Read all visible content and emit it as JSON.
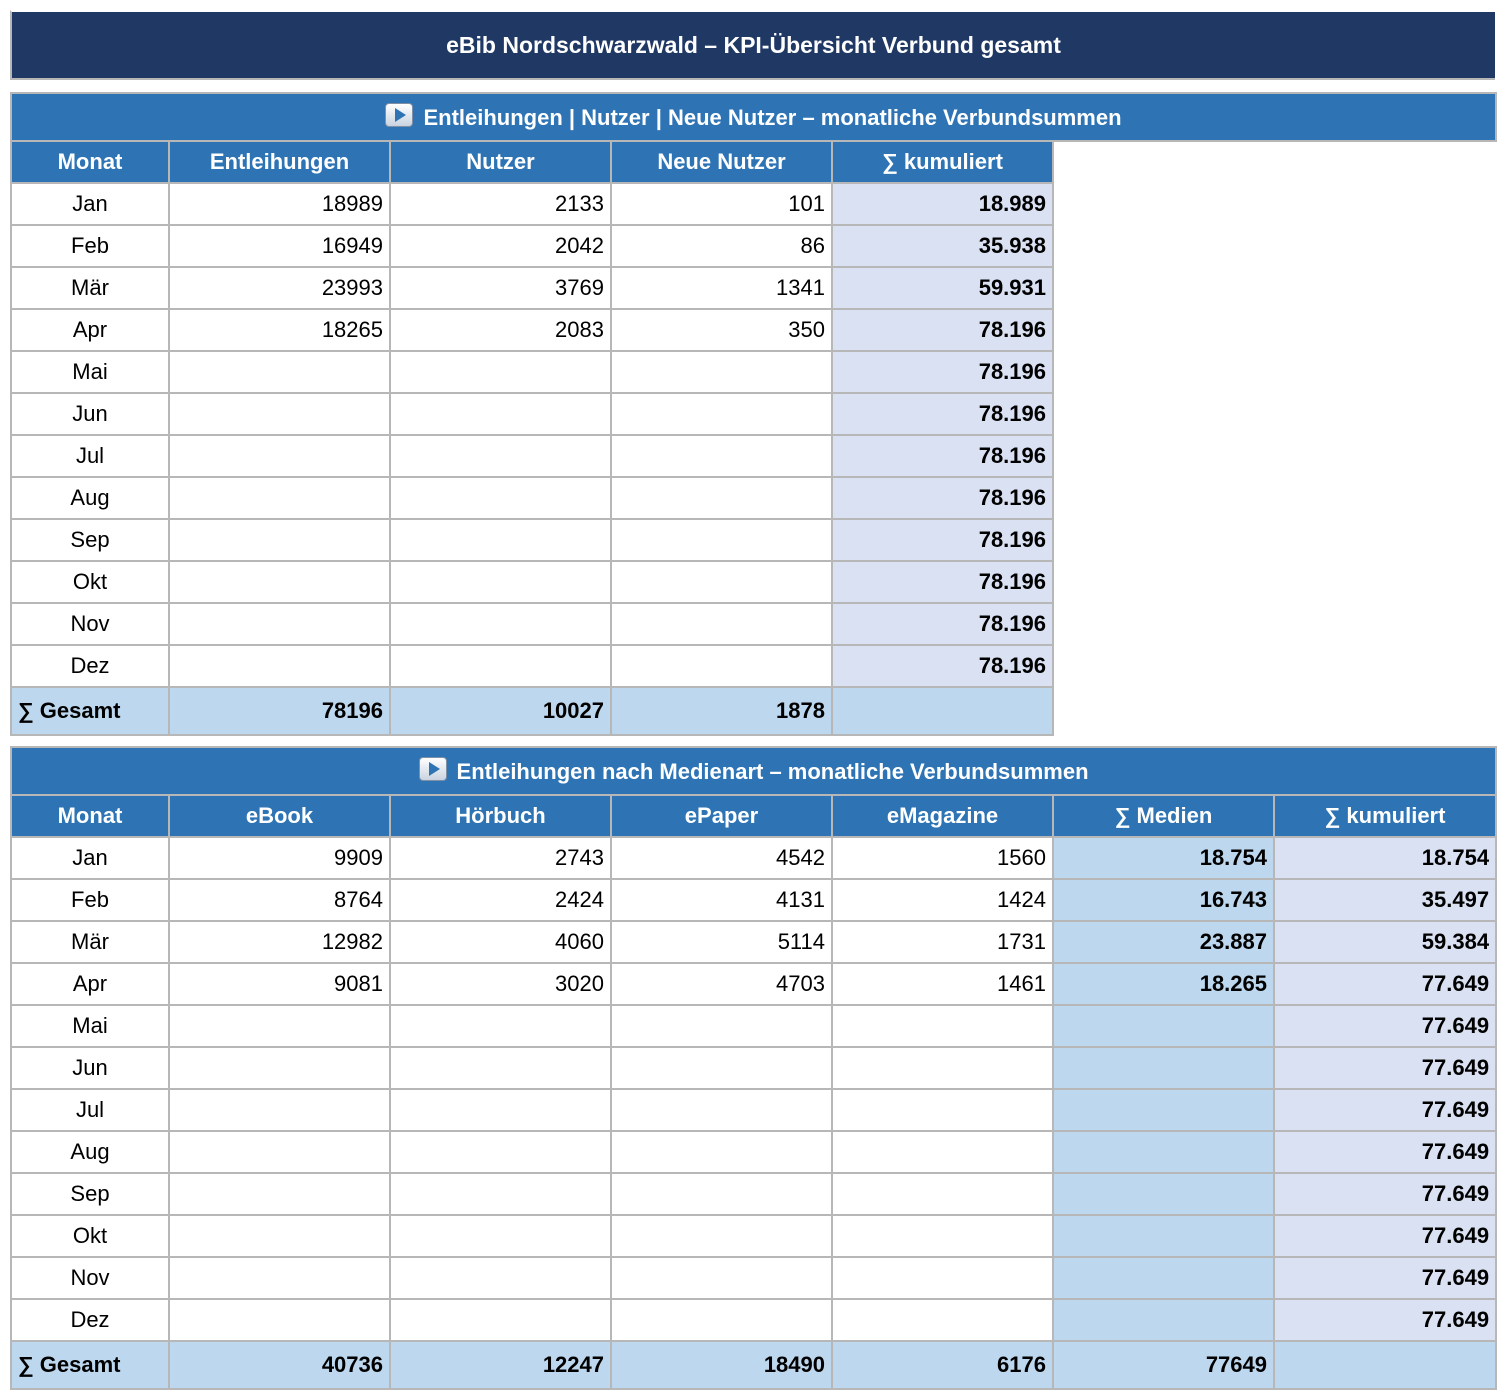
{
  "title": "eBib Nordschwarzwald – KPI-Übersicht Verbund gesamt",
  "table1": {
    "heading": "Entleihungen | Nutzer | Neue Nutzer  –  monatliche Verbundsummen",
    "columns": [
      "Monat",
      "Entleihungen",
      "Nutzer",
      "Neue Nutzer",
      "∑ kumuliert"
    ],
    "rows": [
      {
        "month": "Jan",
        "entleihungen": "18989",
        "nutzer": "2133",
        "neue": "101",
        "kum": "18.989"
      },
      {
        "month": "Feb",
        "entleihungen": "16949",
        "nutzer": "2042",
        "neue": "86",
        "kum": "35.938"
      },
      {
        "month": "Mär",
        "entleihungen": "23993",
        "nutzer": "3769",
        "neue": "1341",
        "kum": "59.931"
      },
      {
        "month": "Apr",
        "entleihungen": "18265",
        "nutzer": "2083",
        "neue": "350",
        "kum": "78.196"
      },
      {
        "month": "Mai",
        "entleihungen": "",
        "nutzer": "",
        "neue": "",
        "kum": "78.196"
      },
      {
        "month": "Jun",
        "entleihungen": "",
        "nutzer": "",
        "neue": "",
        "kum": "78.196"
      },
      {
        "month": "Jul",
        "entleihungen": "",
        "nutzer": "",
        "neue": "",
        "kum": "78.196"
      },
      {
        "month": "Aug",
        "entleihungen": "",
        "nutzer": "",
        "neue": "",
        "kum": "78.196"
      },
      {
        "month": "Sep",
        "entleihungen": "",
        "nutzer": "",
        "neue": "",
        "kum": "78.196"
      },
      {
        "month": "Okt",
        "entleihungen": "",
        "nutzer": "",
        "neue": "",
        "kum": "78.196"
      },
      {
        "month": "Nov",
        "entleihungen": "",
        "nutzer": "",
        "neue": "",
        "kum": "78.196"
      },
      {
        "month": "Dez",
        "entleihungen": "",
        "nutzer": "",
        "neue": "",
        "kum": "78.196"
      }
    ],
    "total": {
      "label": "∑ Gesamt",
      "entleihungen": "78196",
      "nutzer": "10027",
      "neue": "1878"
    }
  },
  "table2": {
    "heading": "Entleihungen nach Medienart  –  monatliche Verbundsummen",
    "columns": [
      "Monat",
      "eBook",
      "Hörbuch",
      "ePaper",
      "eMagazine",
      "∑ Medien",
      "∑ kumuliert"
    ],
    "rows": [
      {
        "month": "Jan",
        "ebook": "9909",
        "hoerbuch": "2743",
        "epaper": "4542",
        "emagazine": "1560",
        "medien": "18.754",
        "kum": "18.754"
      },
      {
        "month": "Feb",
        "ebook": "8764",
        "hoerbuch": "2424",
        "epaper": "4131",
        "emagazine": "1424",
        "medien": "16.743",
        "kum": "35.497"
      },
      {
        "month": "Mär",
        "ebook": "12982",
        "hoerbuch": "4060",
        "epaper": "5114",
        "emagazine": "1731",
        "medien": "23.887",
        "kum": "59.384"
      },
      {
        "month": "Apr",
        "ebook": "9081",
        "hoerbuch": "3020",
        "epaper": "4703",
        "emagazine": "1461",
        "medien": "18.265",
        "kum": "77.649"
      },
      {
        "month": "Mai",
        "ebook": "",
        "hoerbuch": "",
        "epaper": "",
        "emagazine": "",
        "medien": "",
        "kum": "77.649"
      },
      {
        "month": "Jun",
        "ebook": "",
        "hoerbuch": "",
        "epaper": "",
        "emagazine": "",
        "medien": "",
        "kum": "77.649"
      },
      {
        "month": "Jul",
        "ebook": "",
        "hoerbuch": "",
        "epaper": "",
        "emagazine": "",
        "medien": "",
        "kum": "77.649"
      },
      {
        "month": "Aug",
        "ebook": "",
        "hoerbuch": "",
        "epaper": "",
        "emagazine": "",
        "medien": "",
        "kum": "77.649"
      },
      {
        "month": "Sep",
        "ebook": "",
        "hoerbuch": "",
        "epaper": "",
        "emagazine": "",
        "medien": "",
        "kum": "77.649"
      },
      {
        "month": "Okt",
        "ebook": "",
        "hoerbuch": "",
        "epaper": "",
        "emagazine": "",
        "medien": "",
        "kum": "77.649"
      },
      {
        "month": "Nov",
        "ebook": "",
        "hoerbuch": "",
        "epaper": "",
        "emagazine": "",
        "medien": "",
        "kum": "77.649"
      },
      {
        "month": "Dez",
        "ebook": "",
        "hoerbuch": "",
        "epaper": "",
        "emagazine": "",
        "medien": "",
        "kum": "77.649"
      }
    ],
    "total": {
      "label": "∑ Gesamt",
      "ebook": "40736",
      "hoerbuch": "12247",
      "epaper": "18490",
      "emagazine": "6176",
      "medien": "77649"
    }
  },
  "icons": {
    "section_icon": "play-icon"
  },
  "colors": {
    "title_bg": "#1f3864",
    "header_bg": "#2e74b5",
    "total_bg": "#bdd7ee",
    "kum_bg": "#d9e1f2"
  }
}
